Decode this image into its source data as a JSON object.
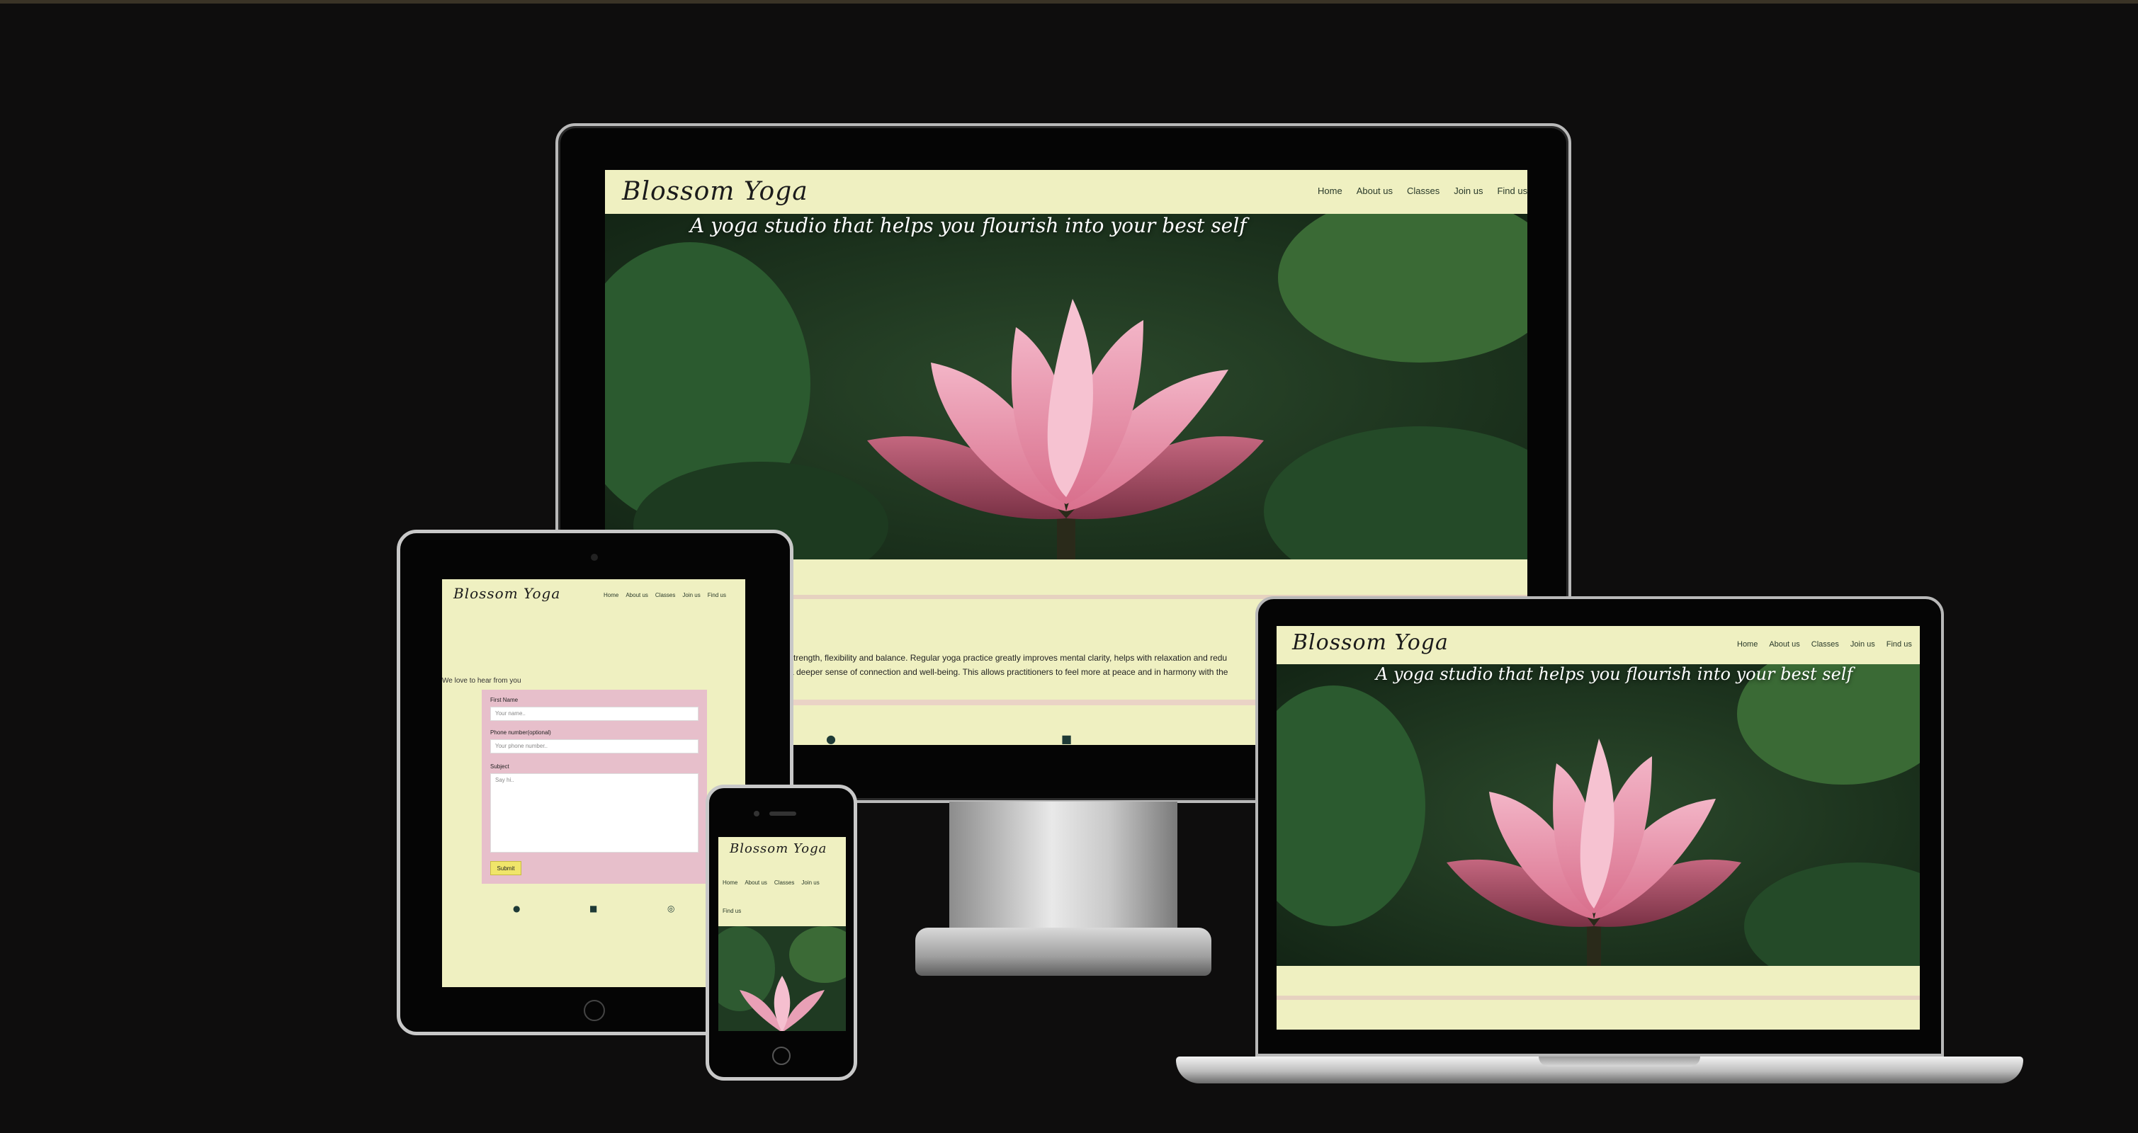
{
  "site": {
    "brand": "Blossom Yoga",
    "nav": [
      "Home",
      "About us",
      "Classes",
      "Join us",
      "Find us"
    ],
    "tagline": "A yoga studio that helps you flourish into your best self",
    "intro_line_1": "strength, flexibility and balance. Regular yoga practice greatly improves mental clarity, helps with relaxation and redu",
    "intro_line_2": "a deeper sense of connection and well-being. This allows practitioners to feel more at peace and in harmony with the"
  },
  "form": {
    "heading": "We love to hear from you",
    "first_name_label": "First Name",
    "first_name_placeholder": "Your name..",
    "phone_label": "Phone number(optional)",
    "phone_placeholder": "Your phone number..",
    "subject_label": "Subject",
    "subject_placeholder": "Say hi..",
    "submit_label": "Submit"
  },
  "icons": {
    "facebook": "facebook-icon",
    "twitter": "twitter-square-icon",
    "instagram": "instagram-icon"
  },
  "colors": {
    "site_background": "#eff0c1",
    "form_background": "#e7bfcb",
    "submit_button": "#f0e56a",
    "page_background": "#0e0d0d"
  }
}
